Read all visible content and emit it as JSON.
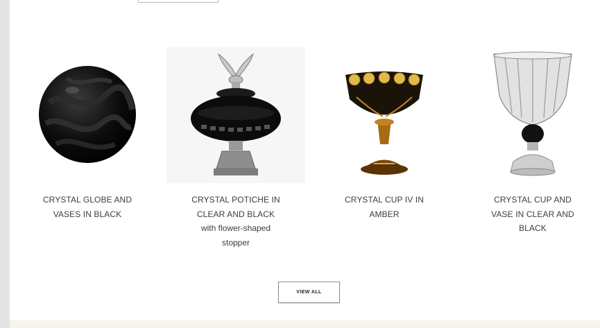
{
  "products": [
    {
      "name_line1": "CRYSTAL GLOBE AND",
      "name_line2": "VASES IN BLACK",
      "subtitle": "",
      "icon": "black-crystal-globe-vase"
    },
    {
      "name_line1": "CRYSTAL POTICHE IN",
      "name_line2": "CLEAR AND BLACK",
      "subtitle_line1": "with flower-shaped",
      "subtitle_line2": "stopper",
      "icon": "crystal-potiche-jar"
    },
    {
      "name_line1": "CRYSTAL CUP IV IN",
      "name_line2": "AMBER",
      "subtitle": "",
      "icon": "amber-crystal-cup"
    },
    {
      "name_line1": "CRYSTAL CUP AND",
      "name_line2": "VASE IN CLEAR AND",
      "name_line3": "BLACK",
      "icon": "clear-black-crystal-cup-vase"
    }
  ],
  "view_all_label": "VIEW ALL",
  "colors": {
    "background": "#ffffff",
    "text": "#3c3c3c",
    "button_border": "#8c8c8c"
  }
}
